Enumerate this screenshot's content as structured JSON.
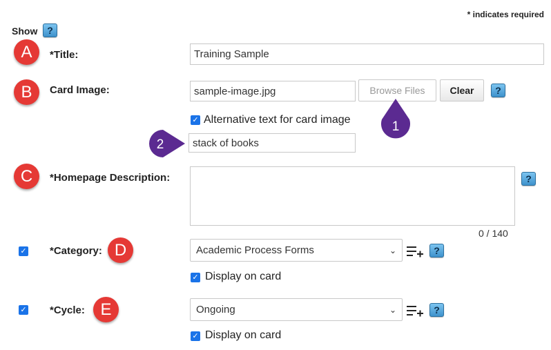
{
  "header": {
    "required_note": "* indicates required",
    "show_label": "Show",
    "help_glyph": "?"
  },
  "badges": {
    "a": "A",
    "b": "B",
    "c": "C",
    "d": "D",
    "e": "E",
    "one": "1",
    "two": "2"
  },
  "title_field": {
    "label": "*Title:",
    "value": "Training Sample"
  },
  "card_image": {
    "label": "Card Image:",
    "filename": "sample-image.jpg",
    "browse_label": "Browse Files",
    "clear_label": "Clear",
    "alt_checkbox_label": "Alternative text for card image",
    "alt_text_value": "stack of books"
  },
  "homepage_description": {
    "label": "*Homepage Description:",
    "value": "",
    "counter": "0 / 140"
  },
  "category": {
    "label": "*Category:",
    "selected": "Academic Process Forms",
    "display_label": "Display on card"
  },
  "cycle": {
    "label": "*Cycle:",
    "selected": "Ongoing",
    "display_label": "Display on card"
  },
  "colors": {
    "badge_red": "#e53935",
    "callout_purple": "#5b2a91",
    "checkbox_blue": "#1a73e8",
    "help_blue": "#3e92cc"
  }
}
